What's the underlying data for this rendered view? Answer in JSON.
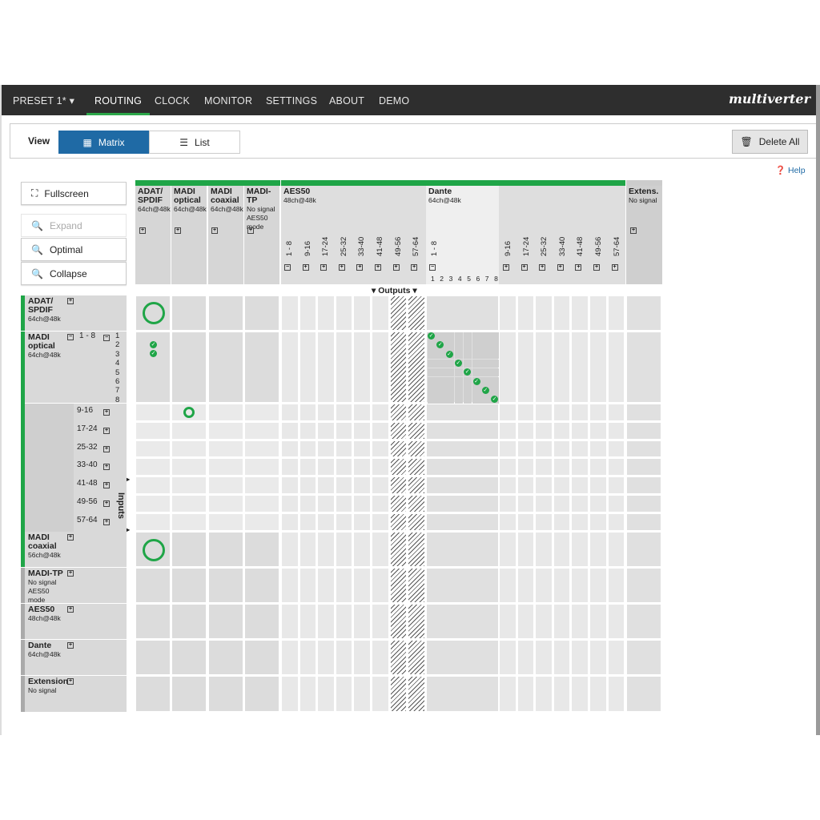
{
  "nav": {
    "preset": "PRESET 1*",
    "items": [
      "ROUTING",
      "CLOCK",
      "MONITOR",
      "SETTINGS",
      "ABOUT",
      "DEMO"
    ],
    "brand": "multiverter"
  },
  "view": {
    "label": "View",
    "matrix": "Matrix",
    "list": "List",
    "delete_all": "Delete All"
  },
  "help": "Help",
  "side": {
    "fullscreen": "Fullscreen",
    "expand": "Expand",
    "optimal": "Optimal",
    "collapse": "Collapse"
  },
  "outputs_label": "Outputs",
  "inputs_label": "Inputs",
  "outputs": [
    {
      "name": "ADAT/ SPDIF",
      "info": "64ch@48k"
    },
    {
      "name": "MADI optical",
      "info": "64ch@48k"
    },
    {
      "name": "MADI coaxial",
      "info": "64ch@48k"
    },
    {
      "name": "MADI-TP",
      "info": "No signal",
      "info2": "AES50 mode"
    },
    {
      "name": "AES50",
      "info": "48ch@48k"
    },
    {
      "name": "Dante",
      "info": "64ch@48k"
    },
    {
      "name": "Extens.",
      "info": "No signal"
    }
  ],
  "aes50_groups": [
    "1 - 8",
    "9-16",
    "17-24",
    "25-32",
    "33-40",
    "41-48",
    "49-56",
    "57-64"
  ],
  "dante_groups": [
    "1 - 8",
    "9-16",
    "17-24",
    "25-32",
    "33-40",
    "41-48",
    "49-56",
    "57-64"
  ],
  "dante_channels": [
    "1",
    "2",
    "3",
    "4",
    "5",
    "6",
    "7",
    "8"
  ],
  "inputs": [
    {
      "name": "ADAT/ SPDIF",
      "info": "64ch@48k"
    },
    {
      "name": "MADI optical",
      "info": "64ch@48k",
      "group": "1 - 8"
    },
    {
      "name": "MADI coaxial",
      "info": "56ch@48k"
    },
    {
      "name": "MADI-TP",
      "info": "No signal",
      "info2": "AES50 mode"
    },
    {
      "name": "AES50",
      "info": "48ch@48k"
    },
    {
      "name": "Dante",
      "info": "64ch@48k"
    },
    {
      "name": "Extension",
      "info": "No signal"
    }
  ],
  "madi_channels": [
    "1",
    "2",
    "3",
    "4",
    "5",
    "6",
    "7",
    "8"
  ],
  "madi_groups": [
    "9-16",
    "17-24",
    "25-32",
    "33-40",
    "41-48",
    "49-56",
    "57-64"
  ],
  "colors": {
    "accent": "#1fa547",
    "primary": "#1f6aa5",
    "nav": "#2e2e2e"
  }
}
